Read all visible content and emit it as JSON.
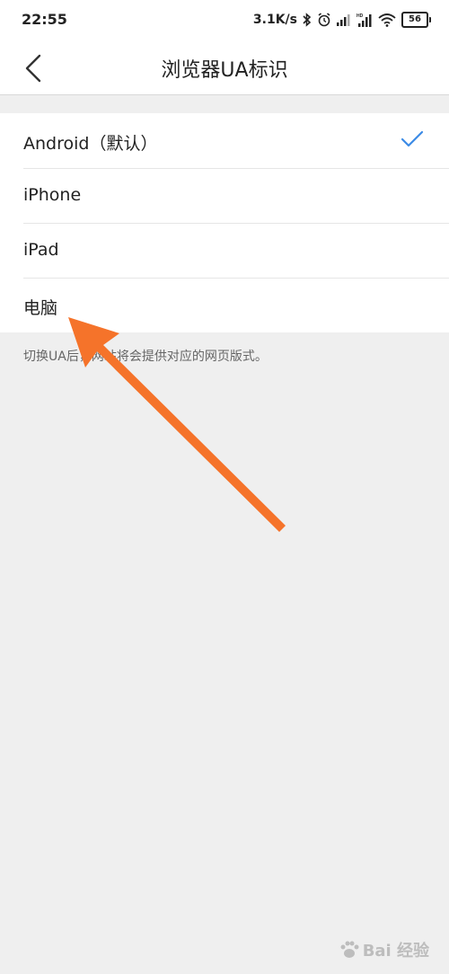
{
  "status_bar": {
    "time": "22:55",
    "net_speed": "3.1K/s",
    "battery_level": "56",
    "icons": [
      "bluetooth-icon",
      "alarm-icon",
      "signal-icon",
      "signal-hd-icon",
      "wifi-icon",
      "battery-icon"
    ]
  },
  "nav": {
    "title": "浏览器UA标识",
    "back_icon": "chevron-left-icon"
  },
  "options": [
    {
      "label": "Android（默认）",
      "selected": true
    },
    {
      "label": "iPhone",
      "selected": false
    },
    {
      "label": "iPad",
      "selected": false
    },
    {
      "label": "电脑",
      "selected": false
    }
  ],
  "hint": "切换UA后，网站将会提供对应的网页版式。",
  "overlay": {
    "arrow_color": "#f5732a"
  },
  "watermark": {
    "text": "Bai 经验"
  },
  "colors": {
    "accent": "#3c8be6",
    "background": "#efefef",
    "surface": "#ffffff"
  }
}
